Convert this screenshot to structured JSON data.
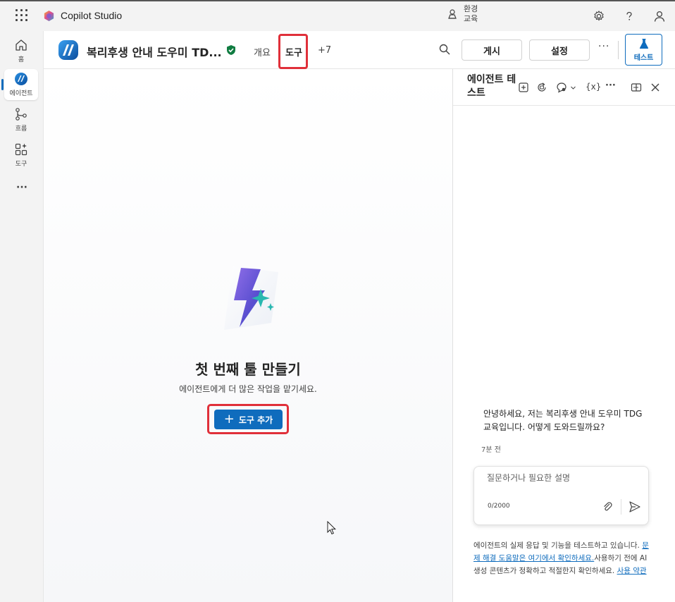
{
  "app": {
    "name": "Copilot Studio",
    "environment_label": "환경",
    "environment_name": "교육"
  },
  "rail": {
    "items": [
      {
        "label": "홈",
        "icon": "home-icon"
      },
      {
        "label": "에이전트",
        "icon": "agent-icon"
      },
      {
        "label": "흐름",
        "icon": "flow-icon"
      },
      {
        "label": "도구",
        "icon": "tools-icon"
      }
    ],
    "more": "···"
  },
  "header": {
    "agent_title": "복리후생 안내 도우미 TD...",
    "tabs": [
      {
        "label": "개요"
      },
      {
        "label": "도구"
      },
      {
        "label": "+7"
      }
    ],
    "publish_label": "게시",
    "settings_label": "설정",
    "more": "···",
    "test_label": "테스트"
  },
  "main": {
    "empty_title": "첫 번째 툴 만들기",
    "empty_subtitle": "에이전트에게 더 많은 작업을 맡기세요.",
    "add_button_label": "도구 추가"
  },
  "test_pane": {
    "title": "에이전트 테스트",
    "bot_message": "안녕하세요, 저는 복리후생 안내 도우미 TDG 교육입니다. 어떻게 도와드릴까요?",
    "message_time": "7분 전",
    "input_placeholder": "질문하거나 필요한 설명",
    "char_count": "0/2000",
    "disclaimer_1": "에이전트의 실제 응답 및 기능을 테스트하고 있습니다. ",
    "disclaimer_link_1": "문제 해결 도움말은 여기에서 확인하세요.",
    "disclaimer_2": "사용하기 전에 AI 생성 콘텐츠가 정확하고 적절한지 확인하세요. ",
    "disclaimer_link_2": "사용 약관"
  },
  "colors": {
    "accent": "#0f6cbd",
    "highlight": "#e0303a",
    "verified": "#107c41"
  }
}
